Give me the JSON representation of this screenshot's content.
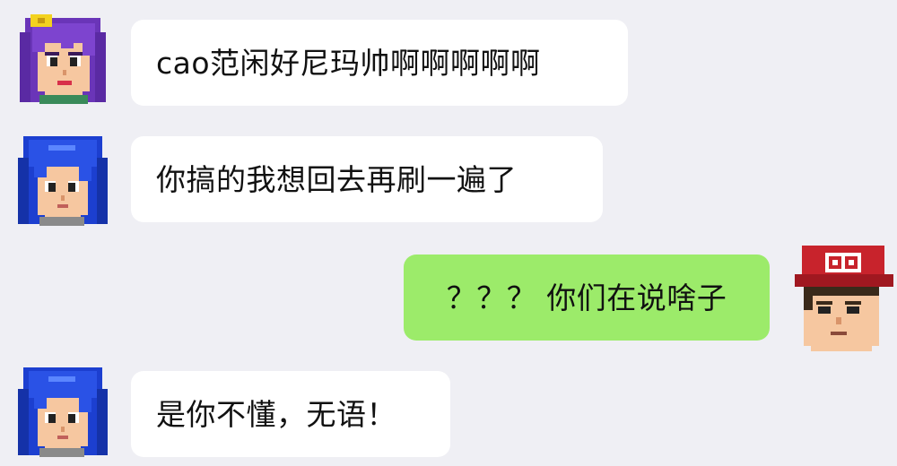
{
  "colors": {
    "background": "#efeff4",
    "incoming_bubble": "#ffffff",
    "outgoing_bubble": "#9ceb6a",
    "text": "#111111"
  },
  "messages": [
    {
      "side": "left",
      "avatar_icon": "purple-hair-girl-avatar-icon",
      "text": "cao范闲好尼玛帅啊啊啊啊啊"
    },
    {
      "side": "left",
      "avatar_icon": "blue-hair-girl-avatar-icon",
      "text": "你搞的我想回去再刷一遍了"
    },
    {
      "side": "right",
      "avatar_icon": "qq-cap-boy-avatar-icon",
      "text": "？？？ 你们在说啥子"
    },
    {
      "side": "left",
      "avatar_icon": "blue-hair-girl-avatar-icon",
      "text": "是你不懂，无语！"
    }
  ]
}
